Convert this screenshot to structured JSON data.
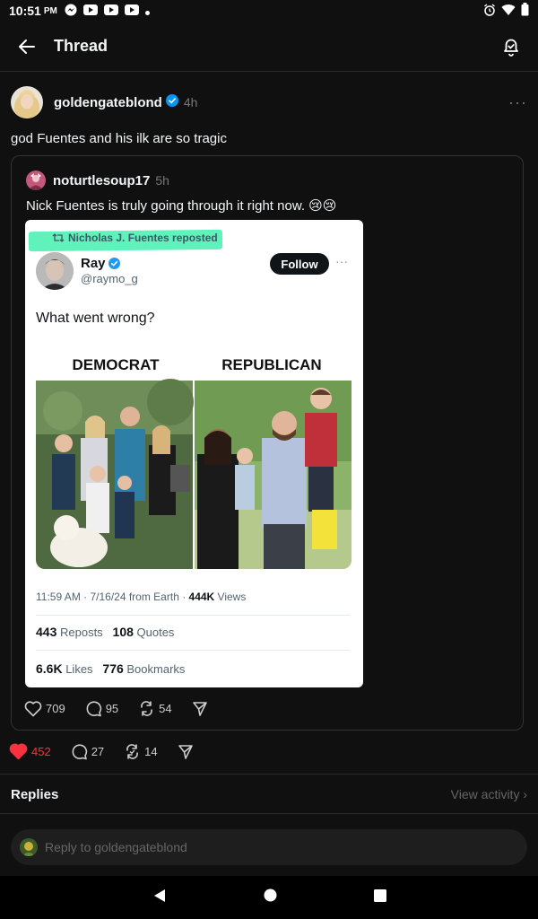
{
  "status_bar": {
    "time": "10:51",
    "ampm": "PM"
  },
  "header": {
    "title": "Thread"
  },
  "post": {
    "username": "goldengateblond",
    "time": "4h",
    "more": "···",
    "text": "god Fuentes and his ilk are so tragic",
    "quote": {
      "username": "noturtlesoup17",
      "time": "5h",
      "text": "Nick Fuentes is truly going through it right now. 😢😢",
      "tweet": {
        "repost_label": "Nicholas J. Fuentes reposted",
        "name": "Ray",
        "handle": "@raymo_g",
        "follow_label": "Follow",
        "more": "···",
        "text": "What went wrong?",
        "meme_left_label": "DEMOCRAT",
        "meme_right_label": "REPUBLICAN",
        "meta_time": "11:59 AM · 7/16/24 from Earth · ",
        "meta_views_count": "444K",
        "meta_views_label": " Views",
        "reposts_count": "443",
        "reposts_label": "Reposts",
        "quotes_count": "108",
        "quotes_label": "Quotes",
        "likes_count": "6.6K",
        "likes_label": "Likes",
        "bookmarks_count": "776",
        "bookmarks_label": "Bookmarks"
      },
      "likes": "709",
      "comments": "95",
      "reposts": "54"
    },
    "likes": "452",
    "comments": "27",
    "reposts": "14"
  },
  "replies": {
    "title": "Replies",
    "view_activity": "View activity ›"
  },
  "reply_bar": {
    "placeholder": "Reply to goldengateblond"
  },
  "colors": {
    "background": "#101010",
    "like_red": "#ff3040",
    "verified_blue": "#0095f6",
    "highlight_green": "#5ff2ba"
  }
}
